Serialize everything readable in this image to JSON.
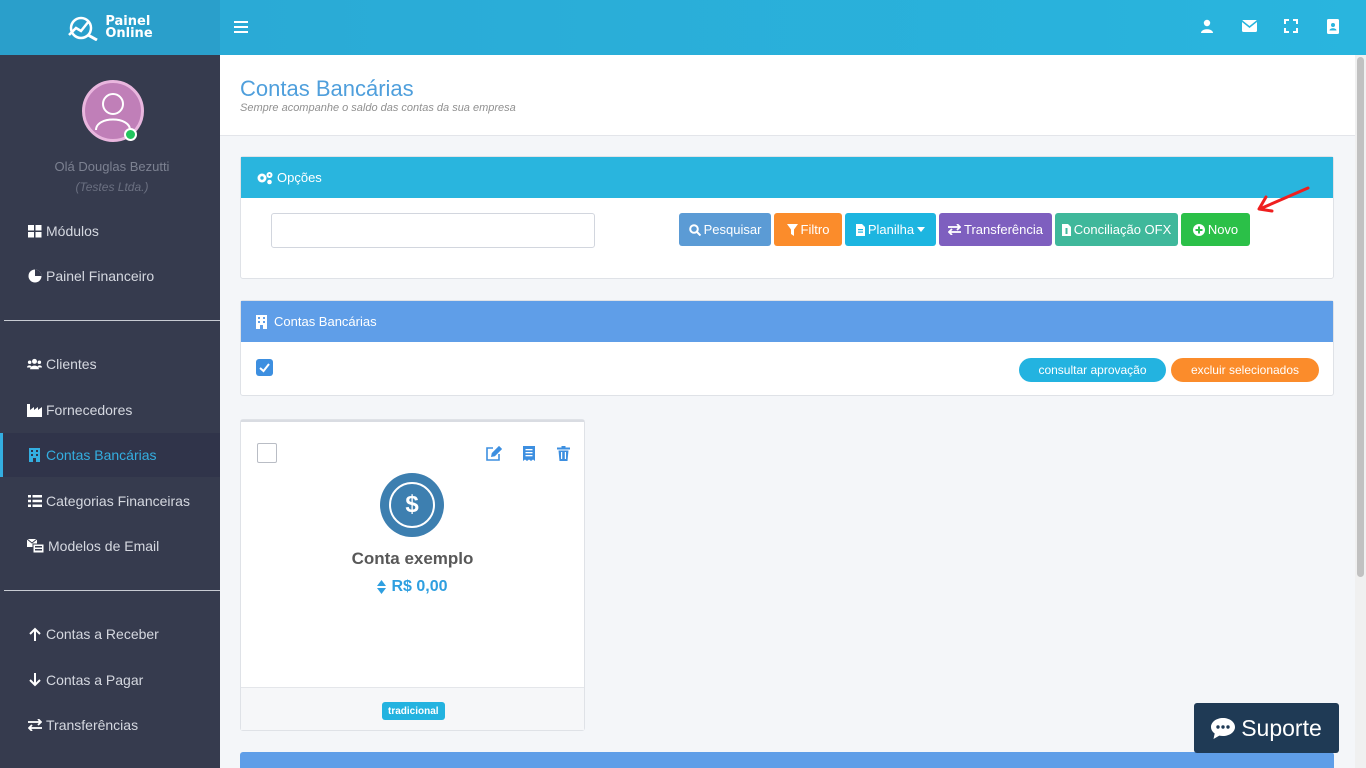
{
  "brand": {
    "line1": "Painel",
    "line2": "Online"
  },
  "user": {
    "greeting": "Olá Douglas Bezutti",
    "company": "(Testes Ltda.)"
  },
  "sidebar": {
    "items": [
      {
        "label": "Módulos",
        "icon": "grid-icon"
      },
      {
        "label": "Painel Financeiro",
        "icon": "pie-chart-icon"
      },
      {
        "label": "Clientes",
        "icon": "users-icon"
      },
      {
        "label": "Fornecedores",
        "icon": "factory-icon"
      },
      {
        "label": "Contas Bancárias",
        "icon": "building-icon",
        "active": true
      },
      {
        "label": "Categorias Financeiras",
        "icon": "list-icon"
      },
      {
        "label": "Modelos de Email",
        "icon": "email-template-icon"
      },
      {
        "label": "Contas a Receber",
        "icon": "arrow-up-icon"
      },
      {
        "label": "Contas a Pagar",
        "icon": "arrow-down-icon"
      },
      {
        "label": "Transferências",
        "icon": "exchange-icon"
      }
    ]
  },
  "header": {
    "title": "Contas Bancárias",
    "subtitle": "Sempre acompanhe o saldo das contas da sua empresa"
  },
  "options_panel": {
    "title": "Opções",
    "search_value": "",
    "buttons": {
      "search": "Pesquisar",
      "filter": "Filtro",
      "spreadsheet": "Planilha",
      "transfer": "Transferência",
      "ofx": "Conciliação OFX",
      "new": "Novo"
    }
  },
  "accounts_panel": {
    "title": "Contas Bancárias",
    "consult_label": "consultar aprovação",
    "delete_label": "excluir selecionados"
  },
  "account_card": {
    "name": "Conta exemplo",
    "balance": "R$ 0,00",
    "tag": "tradicional"
  },
  "support": {
    "label": "Suporte"
  },
  "colors": {
    "topbar": "#29b5de",
    "sidebar": "#363b4e",
    "accent": "#34aee0",
    "btn_search": "#5b9bd5",
    "btn_filter": "#fb8c2b",
    "btn_sheet": "#1db5e0",
    "btn_transfer": "#7e5fbf",
    "btn_ofx": "#3fb89b",
    "btn_new": "#2bc048"
  }
}
